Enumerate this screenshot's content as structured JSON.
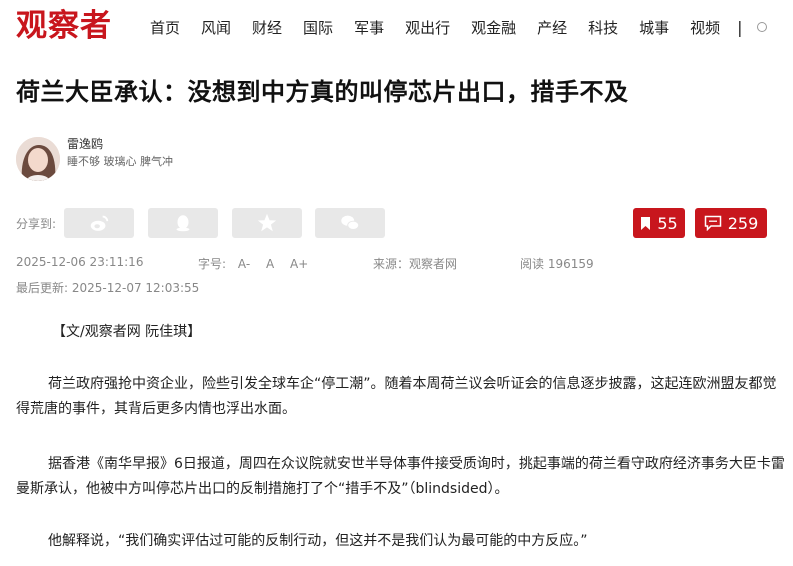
{
  "site": {
    "logo": "观察者"
  },
  "nav": {
    "items": [
      "首页",
      "风闻",
      "财经",
      "国际",
      "军事",
      "观出行",
      "观金融",
      "产经",
      "科技",
      "城事",
      "视频"
    ],
    "separator": "|"
  },
  "article": {
    "title": "荷兰大臣承认：没想到中方真的叫停芯片出口，措手不及",
    "author": {
      "name": "雷逸鸥",
      "bio": "睡不够 玻璃心 脾气冲"
    },
    "share_label": "分享到:",
    "bookmark_count": "55",
    "comment_count": "259",
    "publish_time": "2025-12-06 23:11:16",
    "font_size_label": "字号:",
    "font_options": [
      "A-",
      "A",
      "A+"
    ],
    "source": "来源：观察者网",
    "reads": "阅读 196159",
    "updated": "最后更新: 2025-12-07 12:03:55",
    "byline": "【文/观察者网 阮佳琪】",
    "paragraphs": [
      "荷兰政府强抢中资企业，险些引发全球车企“停工潮”。随着本周荷兰议会听证会的信息逐步披露，这起连欧洲盟友都觉得荒唐的事件，其背后更多内情也浮出水面。",
      "据香港《南华早报》6日报道，周四在众议院就安世半导体事件接受质询时，挑起事端的荷兰看守政府经济事务大臣卡雷曼斯承认，他被中方叫停芯片出口的反制措施打了个“措手不及”（blindsided）。",
      "他解释说，“我们确实评估过可能的反制行动，但这并不是我们认为最可能的中方反应。”"
    ]
  },
  "colors": {
    "brand_red": "#c8161d"
  },
  "icons": [
    "weibo-icon",
    "qq-icon",
    "qzone-star-icon",
    "wechat-icon",
    "bookmark-icon",
    "comment-icon"
  ]
}
